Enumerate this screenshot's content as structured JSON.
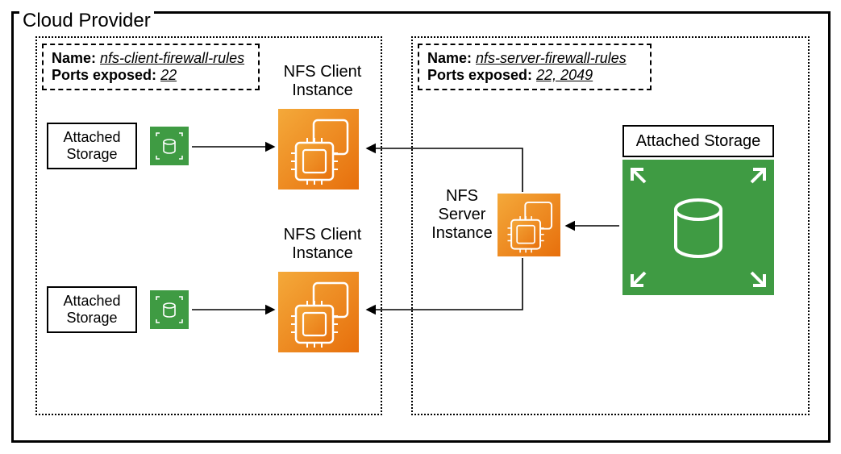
{
  "title": "Cloud Provider",
  "clientGroup": {
    "ruleNameLabel": "Name:",
    "ruleNameValue": "nfs-client-firewall-rules",
    "portsLabel": "Ports exposed:",
    "portsValue": "22",
    "client1": {
      "storage": "Attached Storage",
      "instance": "NFS Client Instance"
    },
    "client2": {
      "storage": "Attached Storage",
      "instance": "NFS Client Instance"
    }
  },
  "serverGroup": {
    "ruleNameLabel": "Name:",
    "ruleNameValue": "nfs-server-firewall-rules",
    "portsLabel": "Ports exposed:",
    "portsValue": "22, 2049",
    "server": {
      "instance": "NFS Server Instance",
      "storage": "Attached Storage"
    }
  }
}
